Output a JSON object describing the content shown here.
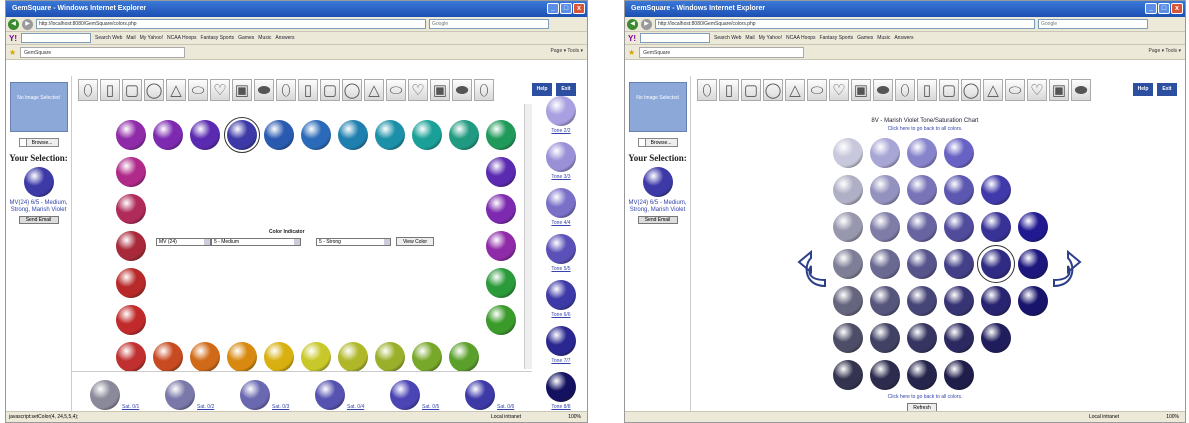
{
  "browser": {
    "title": "GemSquare - Windows Internet Explorer",
    "url": "http://localhost:8080/GemSquare/colors.php",
    "search_placeholder": "Google",
    "toolbar_items": [
      "Search Web",
      "Mail",
      "My Yahoo!",
      "NCAA Hoops",
      "Fantasy Sports",
      "Games",
      "Music",
      "Answers"
    ],
    "tab_label": "GemSquare",
    "tab_tools": "Page ▾  Tools ▾",
    "status_zone": "Local intranet",
    "zoom": "100%"
  },
  "left": {
    "thumb_text": "No Image Selected",
    "browse_label": "Browse...",
    "your_selection": "Your Selection:",
    "selection_name": "MV(24) 6/5 - Medium, Strong, Marish Violet",
    "send_label": "Send Email",
    "selection_color": "#3d3aa8"
  },
  "shapes": [
    "⬯",
    "▯",
    "▢",
    "◯",
    "△",
    "⬭",
    "♡",
    "▣",
    "⬬"
  ],
  "help_label": "Help",
  "exit_label": "Exit",
  "w1": {
    "status_text": "javascript:setColor(4, 24,5,5,4);",
    "ring_colors": [
      "#8f2aa8",
      "#7d2ab0",
      "#5a2ab0",
      "#3d3aa8",
      "#2a5ab0",
      "#2a6ab8",
      "#1f80b0",
      "#1c90a8",
      "#1aa098",
      "#209a80",
      "#1f9a5a",
      "#b02a8a",
      "#b02a5a",
      "#a82a3a",
      "#b82a2a",
      "#c02a2a",
      "#c03030",
      "#c84a20",
      "#d06a18",
      "#d88a10",
      "#d8b010",
      "#c8c82a",
      "#b0b82a",
      "#9ab02a",
      "#78a82a",
      "#5aa02a",
      "#3a9a2a",
      "#2a9a3a"
    ],
    "indicator_title": "Color Indicator",
    "sel1": "MV (24)",
    "sel2": "5 - Medium",
    "sel3": "5 - Strong",
    "view_label": "View Color",
    "tones": [
      "Tone 2/2",
      "Tone 3/3",
      "Tone 4/4",
      "Tone 5/5",
      "Tone 6/6",
      "Tone 7/7",
      "Tone 8/8"
    ],
    "sats": [
      "Sat. 0/1",
      "Sat. 0/2",
      "Sat. 0/3",
      "Sat. 0/4",
      "Sat. 0/5",
      "Sat. 0/6"
    ]
  },
  "w2": {
    "chart_title": "8V - Marish Violet Tone/Saturation Chart",
    "back_link_top": "Click here to go back to all colors.",
    "back_link_bottom": "Click here to go back to all colors.",
    "refresh_label": "Refresh"
  }
}
